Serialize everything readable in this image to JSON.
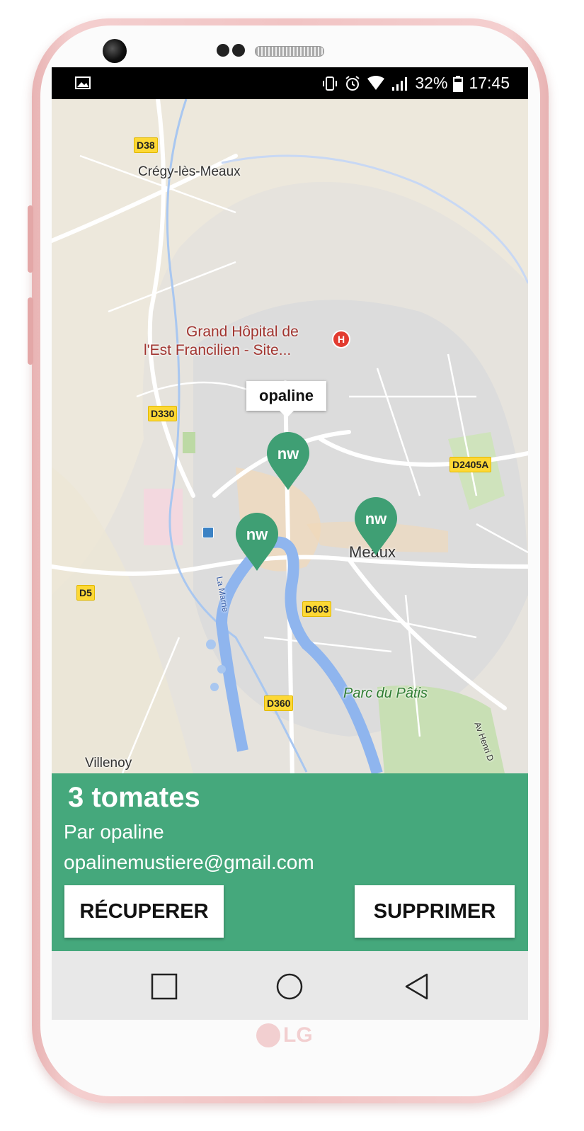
{
  "status_bar": {
    "battery": "32%",
    "time": "17:45",
    "icons": [
      "image-icon",
      "vibrate-icon",
      "alarm-icon",
      "wifi-icon",
      "signal-icon",
      "battery-icon"
    ]
  },
  "map": {
    "road_labels": [
      "D38",
      "D330",
      "D2405A",
      "D5",
      "D603",
      "D360"
    ],
    "place_labels": [
      "Crégy-lès-Meaux",
      "Meaux",
      "Villenoy"
    ],
    "poi": {
      "line1": "Grand Hôpital de",
      "line2": "l'Est Francilien -  Site..."
    },
    "park": "Parc du Pâtis",
    "river": "La Marne",
    "street": "Av Henri D",
    "marker_callout": "opaline",
    "marker_glyph": "nw"
  },
  "info": {
    "title": "3 tomates",
    "author": "Par opaline",
    "email": "opalinemustiere@gmail.com",
    "recover_label": "RÉCUPERER",
    "delete_label": "SUPPRIMER"
  },
  "device": {
    "brand": "LG"
  },
  "colors": {
    "accent": "#45a87c",
    "marker": "#3f9f74"
  }
}
